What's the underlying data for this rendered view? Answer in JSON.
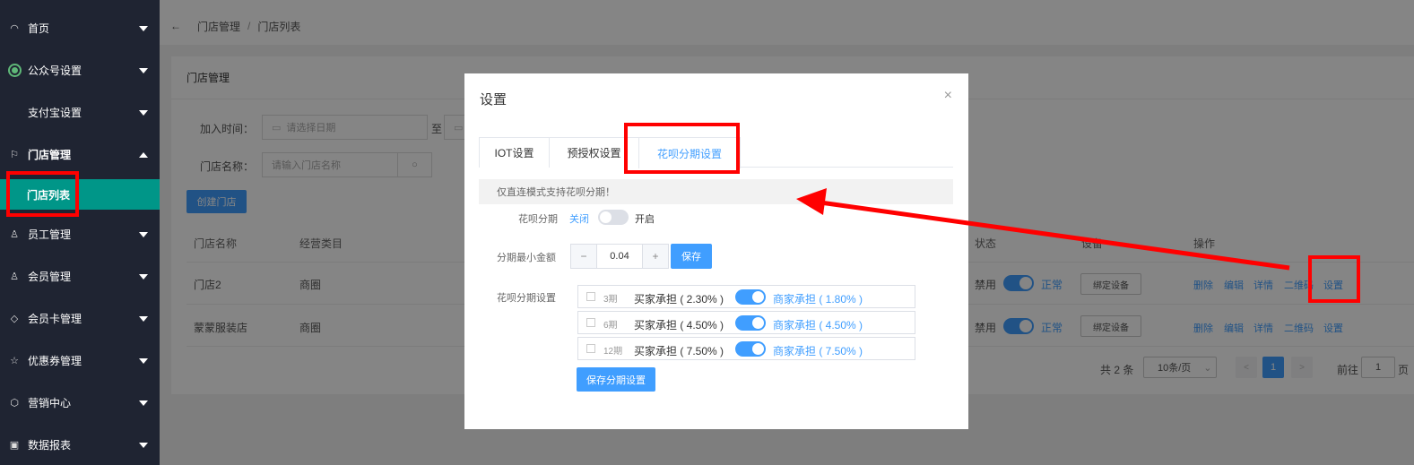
{
  "sidebar": {
    "items": [
      {
        "label": "首页",
        "icon": "dashboard-icon"
      },
      {
        "label": "公众号设置",
        "icon": "wechat-icon"
      },
      {
        "label": "支付宝设置",
        "icon": ""
      },
      {
        "label": "门店管理",
        "icon": "flag-icon"
      },
      {
        "label": "员工管理",
        "icon": "user-icon"
      },
      {
        "label": "会员管理",
        "icon": "user-icon"
      },
      {
        "label": "会员卡管理",
        "icon": "diamond-icon"
      },
      {
        "label": "优惠券管理",
        "icon": "star-icon"
      },
      {
        "label": "营销中心",
        "icon": "box-icon"
      },
      {
        "label": "数据报表",
        "icon": "report-icon"
      }
    ],
    "sub_item": "门店列表"
  },
  "breadcrumb": {
    "back": "←",
    "level1": "门店管理",
    "sep": "/",
    "level2": "门店列表"
  },
  "card": {
    "title": "门店管理",
    "join_time_label": "加入时间：",
    "date_placeholder": "请选择日期",
    "to": "至",
    "store_name_label": "门店名称：",
    "store_name_placeholder": "请输入门店名称",
    "create_button": "创建门店",
    "columns": {
      "name": "门店名称",
      "category": "经营类目",
      "status": "状态",
      "device": "设备",
      "actions": "操作"
    },
    "rows": [
      {
        "name": "门店2",
        "category": "商圈",
        "disable": "禁用",
        "normal": "正常",
        "bind": "绑定设备"
      },
      {
        "name": "蒙蒙服装店",
        "category": "商圈",
        "disable": "禁用",
        "normal": "正常",
        "bind": "绑定设备"
      }
    ],
    "actions": {
      "delete": "删除",
      "edit": "编辑",
      "detail": "详情",
      "qrcode": "二维码",
      "settings": "设置"
    },
    "pagination": {
      "total": "共 2 条",
      "page_size": "10条/页",
      "prev": "<",
      "page": "1",
      "next": ">",
      "goto": "前往",
      "goto_value": "1",
      "page_unit": "页"
    }
  },
  "modal": {
    "title": "设置",
    "close": "×",
    "tabs": [
      "IOT设置",
      "预授权设置",
      "花呗分期设置"
    ],
    "notice": "仅直连模式支持花呗分期！",
    "huabei_label": "花呗分期",
    "off_label": "关闭",
    "on_label": "开启",
    "min_amount_label": "分期最小金额",
    "minus": "−",
    "min_amount": "0.04",
    "plus": "+",
    "save": "保存",
    "plan_label": "花呗分期设置",
    "plans": [
      {
        "period": "3期",
        "buyer": "买家承担 ( 2.30% )",
        "merchant": "商家承担 ( 1.80% )"
      },
      {
        "period": "6期",
        "buyer": "买家承担 ( 4.50% )",
        "merchant": "商家承担 ( 4.50% )"
      },
      {
        "period": "12期",
        "buyer": "买家承担 ( 7.50% )",
        "merchant": "商家承担 ( 7.50% )"
      }
    ],
    "save_plan": "保存分期设置"
  },
  "colors": {
    "sidebar": "#1f2432",
    "active": "#009688",
    "primary": "#409eff",
    "annotation": "#ff0000"
  }
}
